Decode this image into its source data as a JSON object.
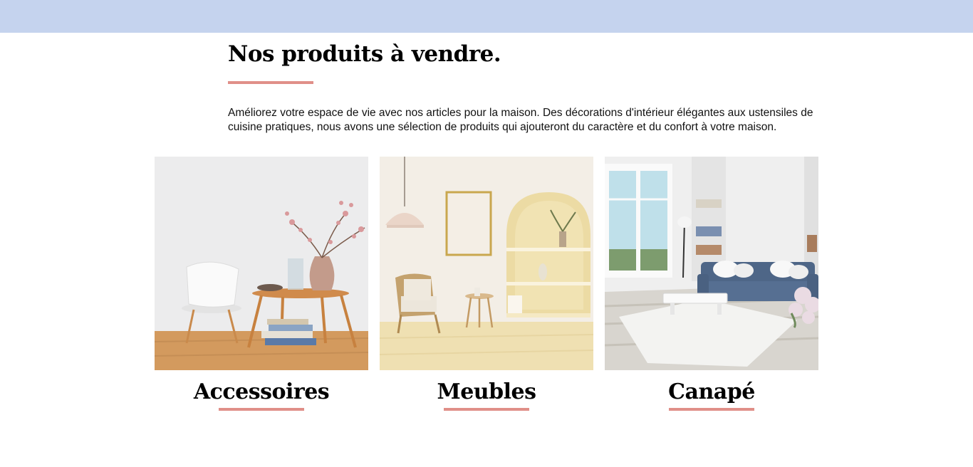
{
  "header": {
    "bar_color": "#c5d3ee"
  },
  "section": {
    "title": "Nos produits à vendre.",
    "description": "Améliorez votre espace de vie avec nos articles pour la maison. Des décorations d'intérieur élégantes aux ustensiles de cuisine pratiques, nous avons une sélection de produits qui ajouteront du caractère et du confort à votre maison.",
    "accent_color": "#e08f88"
  },
  "categories": [
    {
      "label": "Accessoires",
      "image": "side-table-vase-books-photo"
    },
    {
      "label": "Meubles",
      "image": "armchair-arch-shelves-photo"
    },
    {
      "label": "Canapé",
      "image": "blue-sofa-living-room-photo"
    }
  ]
}
